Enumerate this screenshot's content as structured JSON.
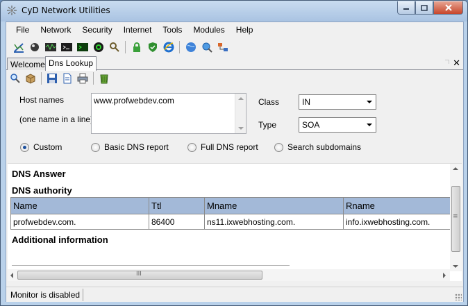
{
  "window": {
    "title": "CyD Network Utilities",
    "controls": {
      "minimize": "minimize",
      "maximize": "maximize",
      "close": "close"
    }
  },
  "menu": [
    "File",
    "Network",
    "Security",
    "Internet",
    "Tools",
    "Modules",
    "Help"
  ],
  "toolbar_icons": [
    "chart-icon",
    "globe-ball-icon",
    "waveform-icon",
    "terminal-icon",
    "console-green-icon",
    "target-icon",
    "search-person-icon",
    "lock-icon",
    "shield-icon",
    "ie-icon",
    "globe-icon",
    "magnifier-globe-icon",
    "network-icon"
  ],
  "tabs": [
    {
      "label": "Welcome",
      "active": false
    },
    {
      "label": "Dns Lookup",
      "active": true
    }
  ],
  "dns": {
    "host_label": "Host names",
    "host_hint": "(one name in a line)",
    "host_value": "www.profwebdev.com",
    "class_label": "Class",
    "class_value": "IN",
    "type_label": "Type",
    "type_value": "SOA",
    "modes": [
      {
        "label": "Custom",
        "checked": true
      },
      {
        "label": "Basic DNS report",
        "checked": false
      },
      {
        "label": "Full DNS report",
        "checked": false
      },
      {
        "label": "Search subdomains",
        "checked": false
      }
    ]
  },
  "results": {
    "answer_heading": "DNS Answer",
    "authority_heading": "DNS authority",
    "columns": [
      "Name",
      "Ttl",
      "Mname",
      "Rname"
    ],
    "rows": [
      [
        "profwebdev.com.",
        "86400",
        "ns11.ixwebhosting.com.",
        "info.ixwebhosting.com."
      ]
    ],
    "additional_heading": "Additional information",
    "hscroll_grip": "III",
    "vscroll_grip": "≡"
  },
  "status": {
    "monitor": "Monitor is disabled"
  },
  "colors": {
    "titlebar": "#b9d1ea",
    "grid_header": "#a3b9d8",
    "radio_accent": "#1c4f9c"
  }
}
